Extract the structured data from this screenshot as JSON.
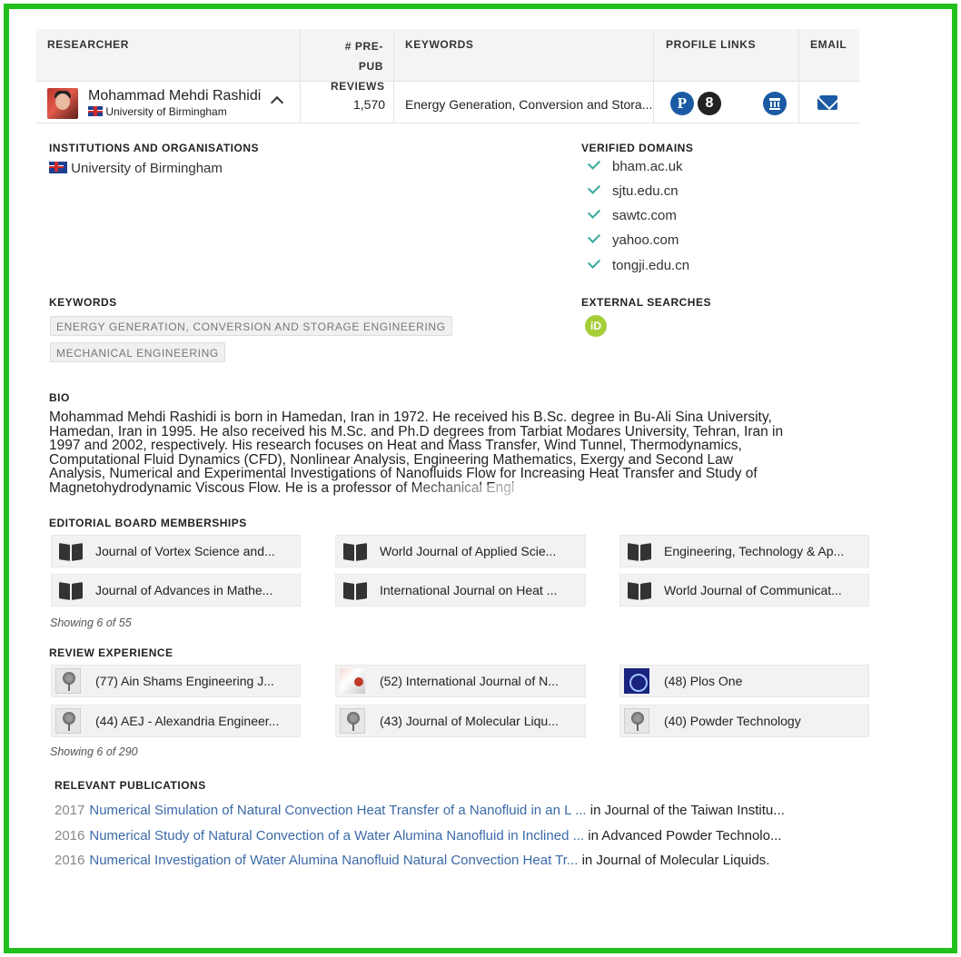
{
  "table": {
    "headers": {
      "researcher": "RESEARCHER",
      "prepub_line1": "# PRE-PUB",
      "prepub_line2": "REVIEWS",
      "keywords": "KEYWORDS",
      "profile_links": "PROFILE LINKS",
      "email": "EMAIL"
    },
    "row": {
      "name": "Mohammad Mehdi Rashidi",
      "institution": "University of Birmingham",
      "reviews": "1,570",
      "keywords": "Energy Generation, Conversion and Stora...",
      "profile_icons": [
        "publons-icon",
        "google-scholar-icon",
        "institution-icon"
      ],
      "profile_icon_letters": {
        "publons": "P",
        "google": "8"
      }
    }
  },
  "institutions": {
    "title": "INSTITUTIONS AND ORGANISATIONS",
    "items": [
      "University of Birmingham"
    ]
  },
  "verified_domains": {
    "title": "VERIFIED DOMAINS",
    "items": [
      "bham.ac.uk",
      "sjtu.edu.cn",
      "sawtc.com",
      "yahoo.com",
      "tongji.edu.cn"
    ]
  },
  "keywords": {
    "title": "KEYWORDS",
    "tags": [
      "ENERGY GENERATION, CONVERSION AND STORAGE ENGINEERING",
      "MECHANICAL ENGINEERING"
    ]
  },
  "external_searches": {
    "title": "EXTERNAL SEARCHES",
    "orcid_label": "iD"
  },
  "bio": {
    "title": "BIO",
    "lines": [
      "Mohammad Mehdi Rashidi is born in Hamedan, Iran in 1972. He received his B.Sc. degree in Bu-Ali Sina University,",
      "Hamedan, Iran in 1995. He also received his M.Sc. and Ph.D degrees from Tarbiat Modares University, Tehran, Iran in",
      "1997 and 2002, respectively. His research focuses on Heat and Mass Transfer, Wind Tunnel, Thermodynamics,",
      "Computational Fluid Dynamics (CFD), Nonlinear Analysis, Engineering Mathematics, Exergy and Second Law",
      "Analysis, Numerical and Experimental Investigations of Nanofluids Flow for Increasing Heat Transfer and Study of",
      "Magnetohydrodynamic Viscous Flow. He is a professor of Mechanical Engi"
    ]
  },
  "editorial": {
    "title": "EDITORIAL BOARD MEMBERSHIPS",
    "items": [
      "Journal of Vortex Science and...",
      "World Journal of Applied Scie...",
      "Engineering, Technology & Ap...",
      "Journal of Advances in Mathe...",
      "International Journal on Heat ...",
      "World Journal of Communicat..."
    ],
    "showing": "Showing 6 of 55"
  },
  "review": {
    "title": "REVIEW EXPERIENCE",
    "items": [
      "(77) Ain Shams Engineering J...",
      "(52) International Journal of N...",
      "(48) Plos One",
      "(44) AEJ - Alexandria Engineer...",
      "(43) Journal of Molecular Liqu...",
      "(40) Powder Technology"
    ],
    "showing": "Showing 6 of 290"
  },
  "publications": {
    "title": "RELEVANT PUBLICATIONS",
    "items": [
      {
        "year": "2017",
        "title": "Numerical Simulation of Natural Convection Heat Transfer of a Nanofluid in an L ...",
        "venue": "in Journal of the Taiwan Institu..."
      },
      {
        "year": "2016",
        "title": "Numerical Study of Natural Convection of a Water Alumina Nanofluid in Inclined ...",
        "venue": "in Advanced Powder Technolo..."
      },
      {
        "year": "2016",
        "title": "Numerical Investigation of Water Alumina Nanofluid Natural Convection Heat Tr...",
        "venue": "in Journal of Molecular Liquids."
      }
    ]
  },
  "colors": {
    "frame": "#22c01c",
    "link": "#3b6aa8",
    "check": "#3aaa9a",
    "email_icon": "#1b5aa3",
    "orcid": "#a6ce39"
  }
}
